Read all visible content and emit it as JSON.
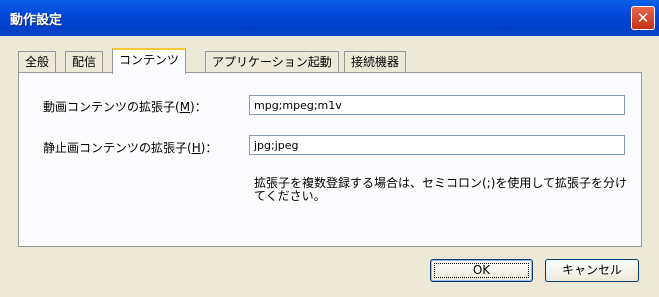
{
  "window": {
    "title": "動作設定",
    "close_glyph": "✕"
  },
  "tabs": [
    "全般",
    "配信",
    "コンテンツ",
    "アプリケーション起動",
    "接続機器"
  ],
  "active_tab": "コンテンツ",
  "fields": {
    "video": {
      "label_pre": "動画コンテンツの拡張子(",
      "mnemonic": "M",
      "label_post": ")：",
      "value": "mpg;mpeg;m1v"
    },
    "image": {
      "label_pre": "静止画コンテンツの拡張子(",
      "mnemonic": "H",
      "label_post": ")：",
      "value": "jpg;jpeg"
    }
  },
  "note": "拡張子を複数登録する場合は、セミコロン(;)を使用して拡張子を分けてください。",
  "buttons": {
    "ok": "OK",
    "cancel": "キャンセル"
  }
}
